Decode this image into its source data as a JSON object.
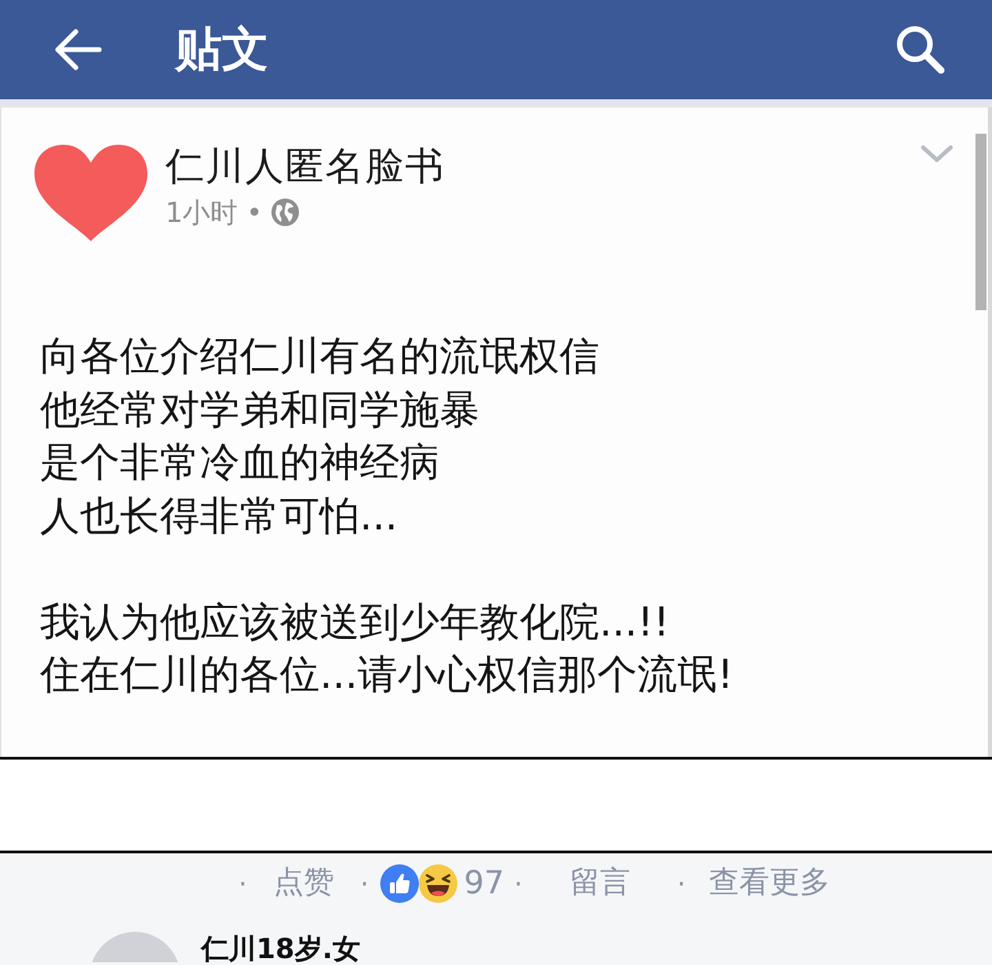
{
  "top_bar": {
    "title": "贴文"
  },
  "post": {
    "author": "仁川人匿名脸书",
    "time": "1小时",
    "separator": "•",
    "paragraphs": [
      {
        "lines": [
          "向各位介绍仁川有名的流氓权信",
          "他经常对学弟和同学施暴",
          "是个非常冷血的神经病",
          "人也长得非常可怕..."
        ]
      },
      {
        "lines": [
          "我认为他应该被送到少年教化院...!!",
          "住在仁川的各位...请小心权信那个流氓!"
        ]
      }
    ]
  },
  "reaction_bar": {
    "items": [
      {
        "kind": "dot",
        "text": "·"
      },
      {
        "kind": "action",
        "label": "点赞"
      },
      {
        "kind": "dot",
        "text": "·"
      },
      {
        "kind": "reactions",
        "count": "97"
      },
      {
        "kind": "dot",
        "text": "·"
      },
      {
        "kind": "action",
        "label": "留言"
      },
      {
        "kind": "dot",
        "text": "·"
      },
      {
        "kind": "action",
        "label": "查看更多"
      }
    ]
  },
  "comment": {
    "author": "仁川18岁.女"
  }
}
